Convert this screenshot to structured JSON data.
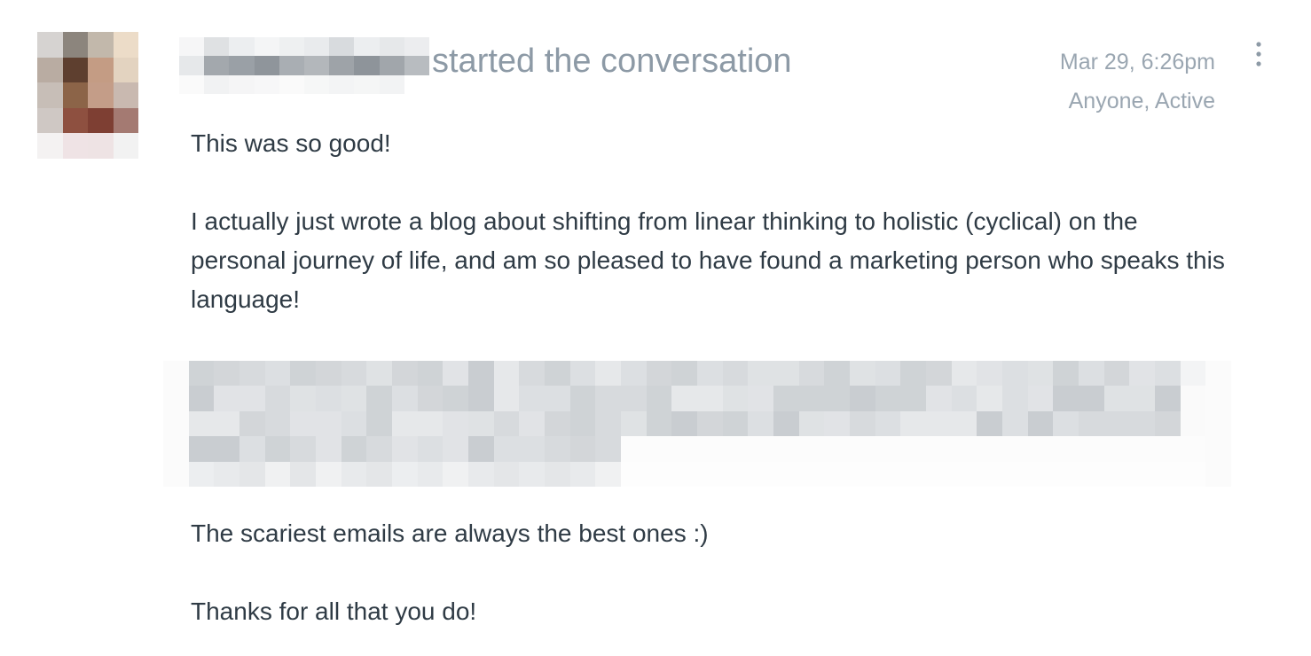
{
  "post": {
    "header_action": "started the conversation",
    "timestamp": "Mar 29, 6:26pm",
    "visibility": "Anyone, Active",
    "more_icon": "vertical-ellipsis-icon",
    "paragraphs": [
      "This was so good!",
      "I actually just wrote a blog about shifting from linear thinking to holistic (cyclical) on the personal journey of life, and am so pleased to have found a marketing person who speaks this language!",
      "The scariest emails are always the best ones :)",
      "Thanks for all that you do!"
    ]
  },
  "colors": {
    "text": "#2f3b45",
    "muted": "#8d9aa6",
    "meta": "#9aa6b1"
  }
}
